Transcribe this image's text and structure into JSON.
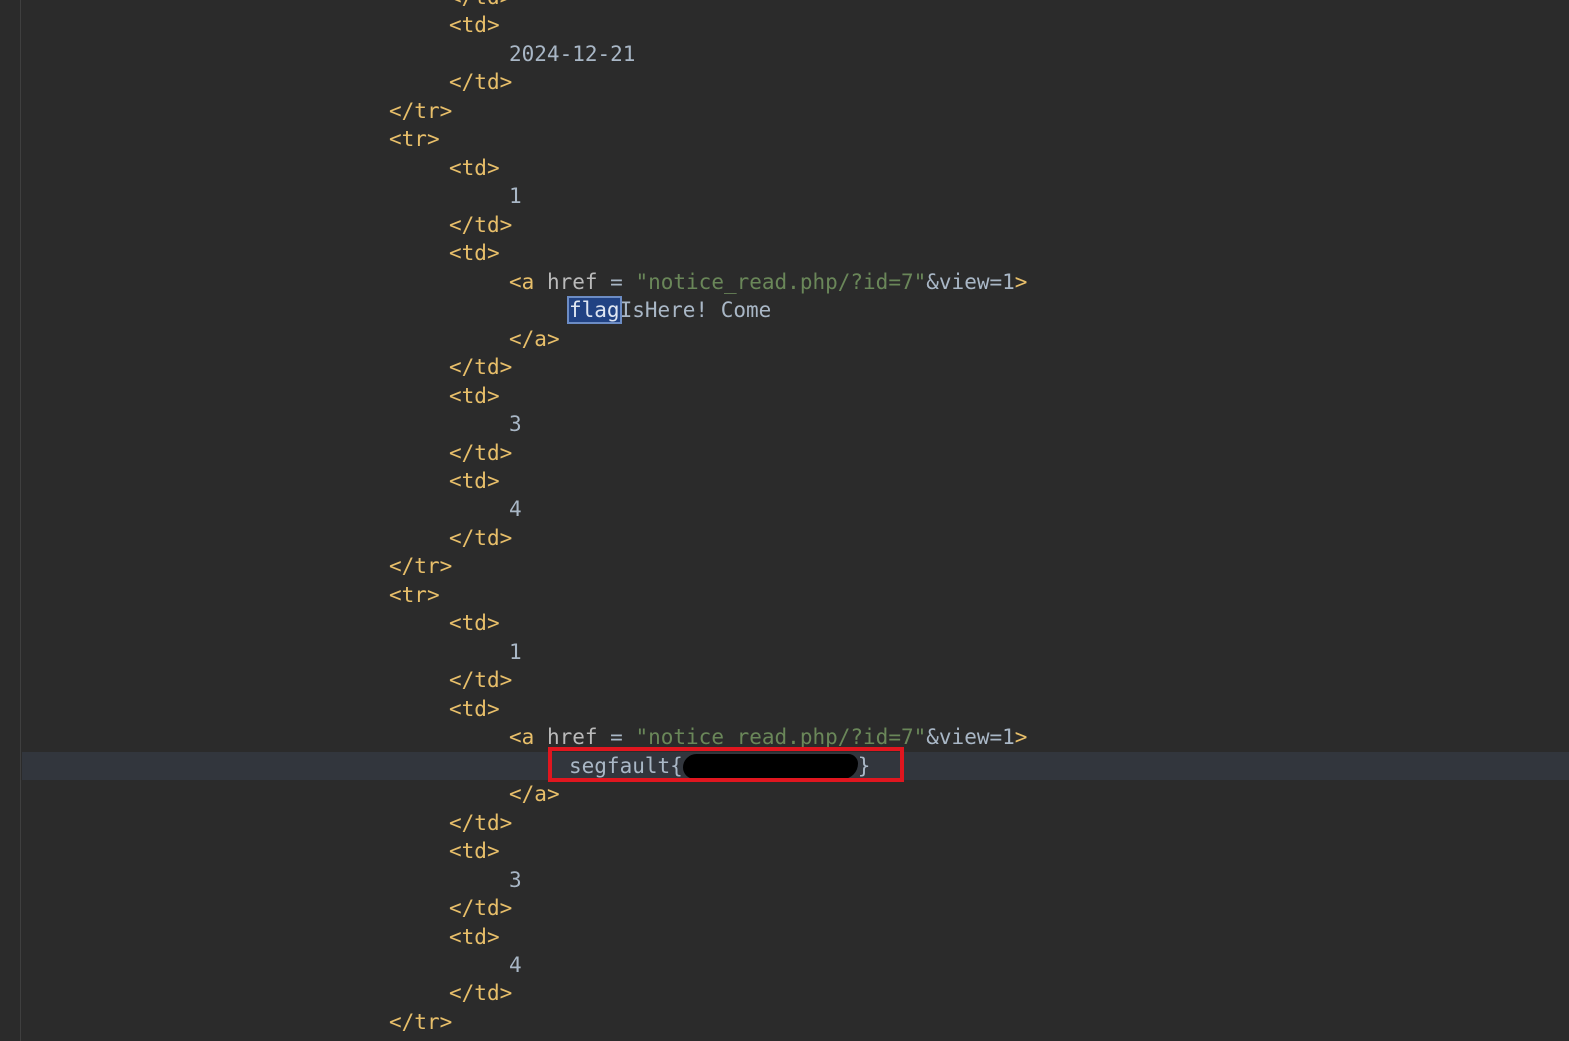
{
  "editor": {
    "lines": [
      {
        "indent": 2,
        "tokens": [
          {
            "t": "</",
            "c": "bracket"
          },
          {
            "t": "td",
            "c": "tag"
          },
          {
            "t": ">",
            "c": "bracket"
          }
        ]
      },
      {
        "indent": 2,
        "tokens": [
          {
            "t": "<",
            "c": "bracket"
          },
          {
            "t": "td",
            "c": "tag"
          },
          {
            "t": ">",
            "c": "bracket"
          }
        ]
      },
      {
        "indent": 3,
        "tokens": [
          {
            "t": "2024-12-21",
            "c": "text"
          }
        ]
      },
      {
        "indent": 2,
        "tokens": [
          {
            "t": "</",
            "c": "bracket"
          },
          {
            "t": "td",
            "c": "tag"
          },
          {
            "t": ">",
            "c": "bracket"
          }
        ]
      },
      {
        "indent": 1,
        "tokens": [
          {
            "t": "</",
            "c": "bracket"
          },
          {
            "t": "tr",
            "c": "tag"
          },
          {
            "t": ">",
            "c": "bracket"
          }
        ]
      },
      {
        "indent": 1,
        "tokens": [
          {
            "t": "<",
            "c": "bracket"
          },
          {
            "t": "tr",
            "c": "tag"
          },
          {
            "t": ">",
            "c": "bracket"
          }
        ]
      },
      {
        "indent": 2,
        "tokens": [
          {
            "t": "<",
            "c": "bracket"
          },
          {
            "t": "td",
            "c": "tag"
          },
          {
            "t": ">",
            "c": "bracket"
          }
        ]
      },
      {
        "indent": 3,
        "tokens": [
          {
            "t": "1",
            "c": "text"
          }
        ]
      },
      {
        "indent": 2,
        "tokens": [
          {
            "t": "</",
            "c": "bracket"
          },
          {
            "t": "td",
            "c": "tag"
          },
          {
            "t": ">",
            "c": "bracket"
          }
        ]
      },
      {
        "indent": 2,
        "tokens": [
          {
            "t": "<",
            "c": "bracket"
          },
          {
            "t": "td",
            "c": "tag"
          },
          {
            "t": ">",
            "c": "bracket"
          }
        ]
      },
      {
        "indent": 3,
        "tokens": [
          {
            "t": "<",
            "c": "bracket"
          },
          {
            "t": "a",
            "c": "tag"
          },
          {
            "t": " href",
            "c": "attr"
          },
          {
            "t": " = ",
            "c": "op"
          },
          {
            "t": "\"notice_read.php/?id=7\"",
            "c": "str"
          },
          {
            "t": "&view=1",
            "c": "entity"
          },
          {
            "t": ">",
            "c": "bracket"
          }
        ]
      },
      {
        "indent": 4,
        "tokens": [
          {
            "t": "flag",
            "c": "search-hit"
          },
          {
            "t": "IsHere! Come",
            "c": "text"
          }
        ]
      },
      {
        "indent": 3,
        "tokens": [
          {
            "t": "</",
            "c": "bracket"
          },
          {
            "t": "a",
            "c": "tag"
          },
          {
            "t": ">",
            "c": "bracket"
          }
        ]
      },
      {
        "indent": 2,
        "tokens": [
          {
            "t": "</",
            "c": "bracket"
          },
          {
            "t": "td",
            "c": "tag"
          },
          {
            "t": ">",
            "c": "bracket"
          }
        ]
      },
      {
        "indent": 2,
        "tokens": [
          {
            "t": "<",
            "c": "bracket"
          },
          {
            "t": "td",
            "c": "tag"
          },
          {
            "t": ">",
            "c": "bracket"
          }
        ]
      },
      {
        "indent": 3,
        "tokens": [
          {
            "t": "3",
            "c": "text"
          }
        ]
      },
      {
        "indent": 2,
        "tokens": [
          {
            "t": "</",
            "c": "bracket"
          },
          {
            "t": "td",
            "c": "tag"
          },
          {
            "t": ">",
            "c": "bracket"
          }
        ]
      },
      {
        "indent": 2,
        "tokens": [
          {
            "t": "<",
            "c": "bracket"
          },
          {
            "t": "td",
            "c": "tag"
          },
          {
            "t": ">",
            "c": "bracket"
          }
        ]
      },
      {
        "indent": 3,
        "tokens": [
          {
            "t": "4",
            "c": "text"
          }
        ]
      },
      {
        "indent": 2,
        "tokens": [
          {
            "t": "</",
            "c": "bracket"
          },
          {
            "t": "td",
            "c": "tag"
          },
          {
            "t": ">",
            "c": "bracket"
          }
        ]
      },
      {
        "indent": 1,
        "tokens": [
          {
            "t": "</",
            "c": "bracket"
          },
          {
            "t": "tr",
            "c": "tag"
          },
          {
            "t": ">",
            "c": "bracket"
          }
        ]
      },
      {
        "indent": 1,
        "tokens": [
          {
            "t": "<",
            "c": "bracket"
          },
          {
            "t": "tr",
            "c": "tag"
          },
          {
            "t": ">",
            "c": "bracket"
          }
        ]
      },
      {
        "indent": 2,
        "tokens": [
          {
            "t": "<",
            "c": "bracket"
          },
          {
            "t": "td",
            "c": "tag"
          },
          {
            "t": ">",
            "c": "bracket"
          }
        ]
      },
      {
        "indent": 3,
        "tokens": [
          {
            "t": "1",
            "c": "text"
          }
        ]
      },
      {
        "indent": 2,
        "tokens": [
          {
            "t": "</",
            "c": "bracket"
          },
          {
            "t": "td",
            "c": "tag"
          },
          {
            "t": ">",
            "c": "bracket"
          }
        ]
      },
      {
        "indent": 2,
        "tokens": [
          {
            "t": "<",
            "c": "bracket"
          },
          {
            "t": "td",
            "c": "tag"
          },
          {
            "t": ">",
            "c": "bracket"
          }
        ]
      },
      {
        "indent": 3,
        "tokens": [
          {
            "t": "<",
            "c": "bracket"
          },
          {
            "t": "a",
            "c": "tag"
          },
          {
            "t": " href",
            "c": "attr"
          },
          {
            "t": " = ",
            "c": "op"
          },
          {
            "t": "\"notice_read.php/?id=7\"",
            "c": "str"
          },
          {
            "t": "&view=1",
            "c": "entity"
          },
          {
            "t": ">",
            "c": "bracket"
          }
        ]
      },
      {
        "indent": 4,
        "current": true,
        "tokens": [
          {
            "t": "segfault{",
            "c": "text"
          },
          {
            "t": "",
            "c": "redacted"
          },
          {
            "t": "}",
            "c": "text"
          }
        ]
      },
      {
        "indent": 3,
        "tokens": [
          {
            "t": "</",
            "c": "bracket"
          },
          {
            "t": "a",
            "c": "tag"
          },
          {
            "t": ">",
            "c": "bracket"
          }
        ]
      },
      {
        "indent": 2,
        "tokens": [
          {
            "t": "</",
            "c": "bracket"
          },
          {
            "t": "td",
            "c": "tag"
          },
          {
            "t": ">",
            "c": "bracket"
          }
        ]
      },
      {
        "indent": 2,
        "tokens": [
          {
            "t": "<",
            "c": "bracket"
          },
          {
            "t": "td",
            "c": "tag"
          },
          {
            "t": ">",
            "c": "bracket"
          }
        ]
      },
      {
        "indent": 3,
        "tokens": [
          {
            "t": "3",
            "c": "text"
          }
        ]
      },
      {
        "indent": 2,
        "tokens": [
          {
            "t": "</",
            "c": "bracket"
          },
          {
            "t": "td",
            "c": "tag"
          },
          {
            "t": ">",
            "c": "bracket"
          }
        ]
      },
      {
        "indent": 2,
        "tokens": [
          {
            "t": "<",
            "c": "bracket"
          },
          {
            "t": "td",
            "c": "tag"
          },
          {
            "t": ">",
            "c": "bracket"
          }
        ]
      },
      {
        "indent": 3,
        "tokens": [
          {
            "t": "4",
            "c": "text"
          }
        ]
      },
      {
        "indent": 2,
        "tokens": [
          {
            "t": "</",
            "c": "bracket"
          },
          {
            "t": "td",
            "c": "tag"
          },
          {
            "t": ">",
            "c": "bracket"
          }
        ]
      },
      {
        "indent": 1,
        "tokens": [
          {
            "t": "</",
            "c": "bracket"
          },
          {
            "t": "tr",
            "c": "tag"
          },
          {
            "t": ">",
            "c": "bracket"
          }
        ]
      }
    ]
  },
  "colors": {
    "background": "#2b2b2b",
    "tag": "#e8bf6a",
    "string": "#6a8759",
    "text": "#a9b7c6",
    "current_line": "#32363d",
    "annotation_box": "#e0161f",
    "search_highlight": "#214283"
  }
}
